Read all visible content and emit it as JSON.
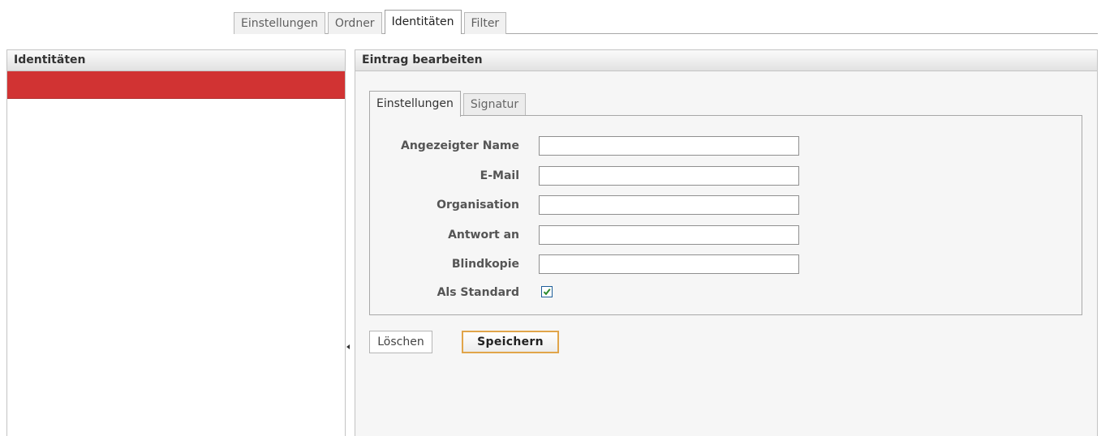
{
  "top_tabs": [
    {
      "label": "Einstellungen",
      "active": false
    },
    {
      "label": "Ordner",
      "active": false
    },
    {
      "label": "Identitäten",
      "active": true
    },
    {
      "label": "Filter",
      "active": false
    }
  ],
  "left_panel": {
    "title": "Identitäten"
  },
  "right_panel": {
    "title": "Eintrag bearbeiten",
    "tabs": [
      {
        "label": "Einstellungen",
        "active": true
      },
      {
        "label": "Signatur",
        "active": false
      }
    ],
    "fields": {
      "name": {
        "label": "Angezeigter Name",
        "value": ""
      },
      "email": {
        "label": "E-Mail",
        "value": ""
      },
      "organization": {
        "label": "Organisation",
        "value": ""
      },
      "reply_to": {
        "label": "Antwort an",
        "value": ""
      },
      "bcc": {
        "label": "Blindkopie",
        "value": ""
      },
      "default": {
        "label": "Als Standard",
        "checked": true
      }
    },
    "buttons": {
      "delete": "Löschen",
      "save": "Speichern"
    }
  },
  "colors": {
    "selected_row": "#d13333",
    "save_border": "#e1a54a",
    "checkmark": "#2e8b2e"
  }
}
